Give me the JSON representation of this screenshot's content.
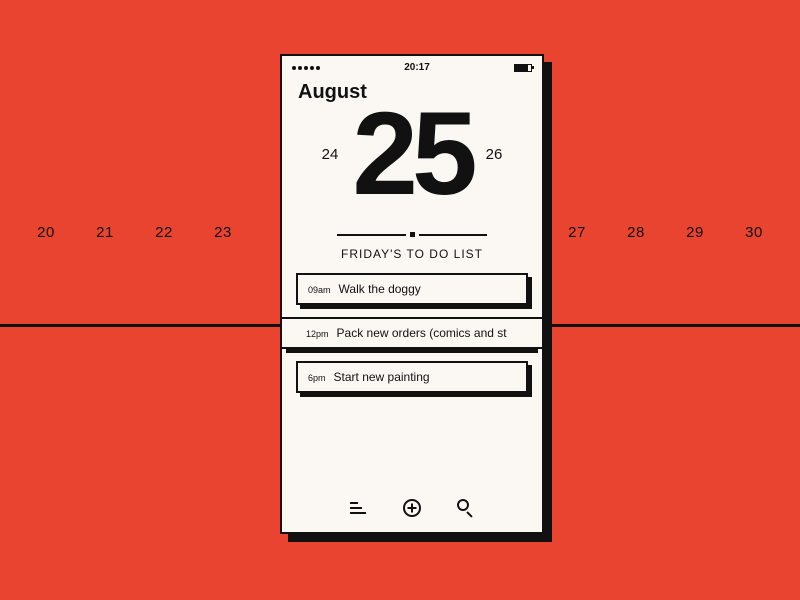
{
  "background": {
    "dates_left": [
      "20",
      "21",
      "22",
      "23"
    ],
    "dates_right": [
      "27",
      "28",
      "29",
      "30"
    ]
  },
  "statusbar": {
    "time": "20:17"
  },
  "header": {
    "month": "August",
    "prev_day": "24",
    "current_day": "25",
    "next_day": "26"
  },
  "list": {
    "title": "FRIDAY'S TO DO LIST",
    "items": [
      {
        "time": "09am",
        "text": "Walk the doggy"
      },
      {
        "time": "12pm",
        "text": "Pack new orders (comics and st"
      },
      {
        "time": "6pm",
        "text": "Start new painting"
      }
    ]
  },
  "colors": {
    "bg": "#e8442f",
    "paper": "#fbf8f4",
    "ink": "#111111"
  }
}
